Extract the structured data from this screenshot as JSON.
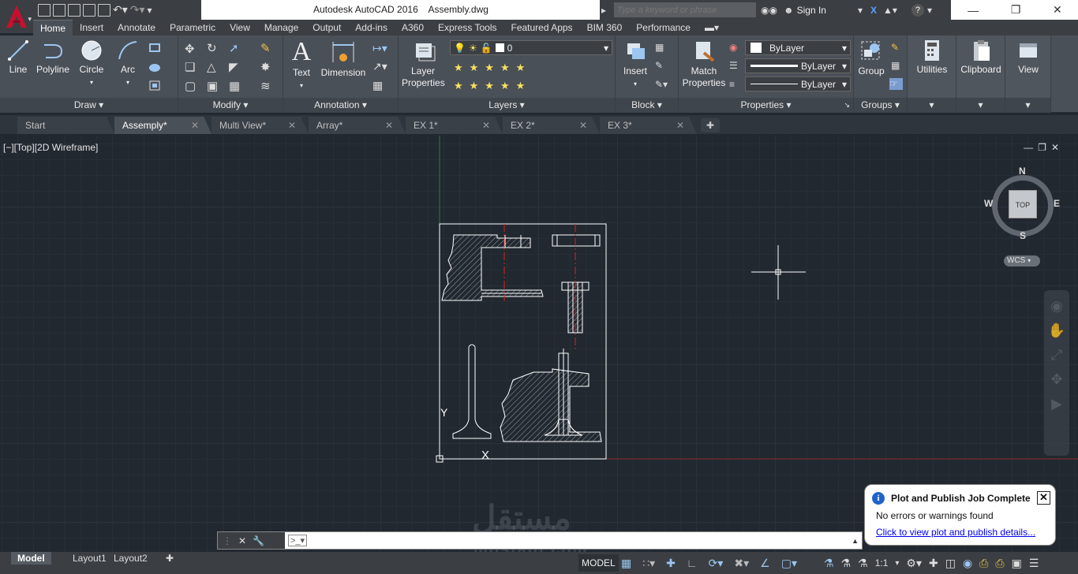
{
  "window": {
    "app_name": "Autodesk AutoCAD 2016",
    "doc_name": "Assembly.dwg",
    "search_placeholder": "Type a keyword or phrase",
    "sign_in": "Sign In"
  },
  "ribbon_tabs": [
    "Home",
    "Insert",
    "Annotate",
    "Parametric",
    "View",
    "Manage",
    "Output",
    "Add-ins",
    "A360",
    "Express Tools",
    "Featured Apps",
    "BIM 360",
    "Performance"
  ],
  "panels": {
    "draw": {
      "title": "Draw",
      "tools": [
        "Line",
        "Polyline",
        "Circle",
        "Arc"
      ]
    },
    "modify": {
      "title": "Modify"
    },
    "annotation": {
      "title": "Annotation",
      "tools": [
        "Text",
        "Dimension"
      ]
    },
    "layers": {
      "title": "Layers",
      "tool": "Layer Properties",
      "current_layer": "0"
    },
    "block": {
      "title": "Block",
      "tool": "Insert"
    },
    "properties": {
      "title": "Properties",
      "tool": "Match Properties",
      "color": "ByLayer",
      "lineweight": "ByLayer",
      "linetype": "ByLayer"
    },
    "groups": {
      "title": "Groups",
      "tool": "Group"
    },
    "utilities": {
      "title": "Utilities"
    },
    "clipboard": {
      "title": "Clipboard"
    },
    "view": {
      "title": "View"
    }
  },
  "file_tabs": [
    {
      "label": "Start",
      "active": false,
      "closable": false
    },
    {
      "label": "Assemply*",
      "active": true,
      "closable": true
    },
    {
      "label": "Multi View*",
      "active": false,
      "closable": true
    },
    {
      "label": "Array*",
      "active": false,
      "closable": true
    },
    {
      "label": "EX 1*",
      "active": false,
      "closable": true
    },
    {
      "label": "EX 2*",
      "active": false,
      "closable": true
    },
    {
      "label": "EX 3*",
      "active": false,
      "closable": true
    }
  ],
  "viewport": {
    "label": "[−][Top][2D Wireframe]",
    "viewcube": {
      "north": "N",
      "south": "S",
      "east": "E",
      "west": "W",
      "face": "TOP",
      "ucs": "WCS"
    }
  },
  "layout_tabs": [
    "Model",
    "Layout1",
    "Layout2"
  ],
  "status": {
    "model": "MODEL",
    "scale": "1:1"
  },
  "notification": {
    "title": "Plot and Publish Job Complete",
    "message": "No errors or warnings found",
    "link": "Click to view plot and publish details..."
  },
  "watermark": {
    "arabic": "مستقل",
    "latin": "mostaql.com"
  },
  "colors": {
    "accent": "#c8102e",
    "ribbon": "#4a5058",
    "viewport": "#212830",
    "link": "#0000ee"
  }
}
